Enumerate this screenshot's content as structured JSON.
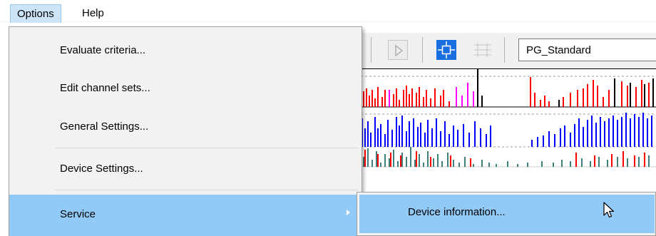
{
  "menubar": {
    "options_label": "Options",
    "help_label": "Help"
  },
  "toolbar": {
    "profile_value": "PG_Standard"
  },
  "options_menu": {
    "items": [
      {
        "label": "Evaluate criteria..."
      },
      {
        "label": "Edit channel sets..."
      },
      {
        "label": "General Settings..."
      },
      {
        "label": "Device Settings..."
      },
      {
        "label": "Service"
      }
    ]
  },
  "service_submenu": {
    "items": [
      {
        "label": "Device information..."
      }
    ]
  },
  "colors": {
    "highlight": "#91c9f7",
    "channel_red": "#ff0000",
    "channel_magenta": "#ff00ff",
    "channel_blue": "#0000ff",
    "channel_teal": "#3d7f7a",
    "channel_black": "#000000"
  },
  "icons": [
    "play-icon",
    "target-icon",
    "waveform-icon",
    "submenu-arrow-icon",
    "mouse-pointer-icon"
  ]
}
